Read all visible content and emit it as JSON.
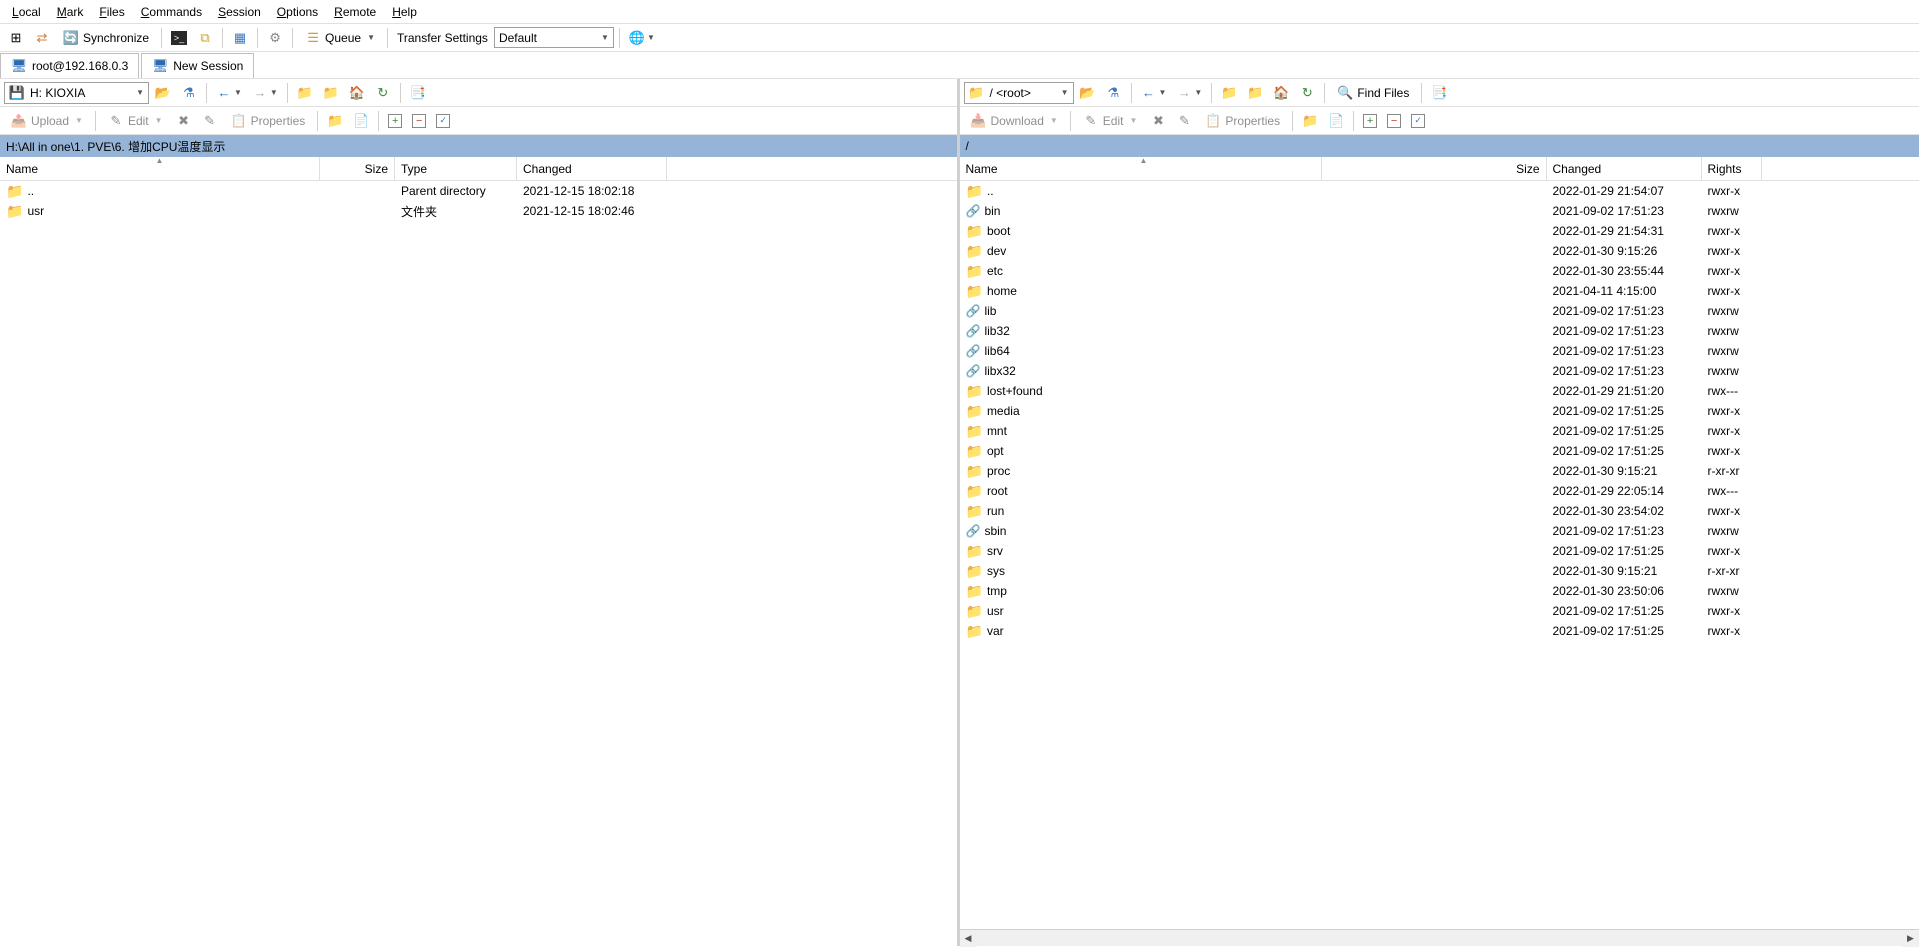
{
  "menu": [
    "Local",
    "Mark",
    "Files",
    "Commands",
    "Session",
    "Options",
    "Remote",
    "Help"
  ],
  "toolbar1": {
    "synchronize": "Synchronize",
    "queue": "Queue",
    "transfer_settings_label": "Transfer Settings",
    "transfer_settings_value": "Default"
  },
  "sessions": {
    "active": "root@192.168.0.3",
    "new": "New Session"
  },
  "local": {
    "drive": "H: KIOXIA",
    "path": "H:\\All in one\\1. PVE\\6. 增加CPU温度显示",
    "upload_label": "Upload",
    "edit_label": "Edit",
    "properties_label": "Properties",
    "headers": [
      "Name",
      "Size",
      "Type",
      "Changed"
    ],
    "rows": [
      {
        "name": "..",
        "icon": "parent",
        "size": "",
        "type": "Parent directory",
        "changed": "2021-12-15  18:02:18"
      },
      {
        "name": "usr",
        "icon": "folder",
        "size": "",
        "type": "文件夹",
        "changed": "2021-12-15  18:02:46"
      }
    ]
  },
  "remote": {
    "drive": "/ <root>",
    "path": "/",
    "download_label": "Download",
    "edit_label": "Edit",
    "properties_label": "Properties",
    "find_files": "Find Files",
    "headers": [
      "Name",
      "Size",
      "Changed",
      "Rights"
    ],
    "rows": [
      {
        "name": "..",
        "icon": "parent",
        "size": "",
        "changed": "2022-01-29 21:54:07",
        "rights": "rwxr-x"
      },
      {
        "name": "bin",
        "icon": "link",
        "size": "",
        "changed": "2021-09-02 17:51:23",
        "rights": "rwxrw"
      },
      {
        "name": "boot",
        "icon": "folder",
        "size": "",
        "changed": "2022-01-29 21:54:31",
        "rights": "rwxr-x"
      },
      {
        "name": "dev",
        "icon": "folder",
        "size": "",
        "changed": "2022-01-30 9:15:26",
        "rights": "rwxr-x"
      },
      {
        "name": "etc",
        "icon": "folder",
        "size": "",
        "changed": "2022-01-30 23:55:44",
        "rights": "rwxr-x"
      },
      {
        "name": "home",
        "icon": "folder",
        "size": "",
        "changed": "2021-04-11 4:15:00",
        "rights": "rwxr-x"
      },
      {
        "name": "lib",
        "icon": "link",
        "size": "",
        "changed": "2021-09-02 17:51:23",
        "rights": "rwxrw"
      },
      {
        "name": "lib32",
        "icon": "link",
        "size": "",
        "changed": "2021-09-02 17:51:23",
        "rights": "rwxrw"
      },
      {
        "name": "lib64",
        "icon": "link",
        "size": "",
        "changed": "2021-09-02 17:51:23",
        "rights": "rwxrw"
      },
      {
        "name": "libx32",
        "icon": "link",
        "size": "",
        "changed": "2021-09-02 17:51:23",
        "rights": "rwxrw"
      },
      {
        "name": "lost+found",
        "icon": "folder",
        "size": "",
        "changed": "2022-01-29 21:51:20",
        "rights": "rwx---"
      },
      {
        "name": "media",
        "icon": "folder",
        "size": "",
        "changed": "2021-09-02 17:51:25",
        "rights": "rwxr-x"
      },
      {
        "name": "mnt",
        "icon": "folder",
        "size": "",
        "changed": "2021-09-02 17:51:25",
        "rights": "rwxr-x"
      },
      {
        "name": "opt",
        "icon": "folder",
        "size": "",
        "changed": "2021-09-02 17:51:25",
        "rights": "rwxr-x"
      },
      {
        "name": "proc",
        "icon": "folder",
        "size": "",
        "changed": "2022-01-30 9:15:21",
        "rights": "r-xr-xr"
      },
      {
        "name": "root",
        "icon": "folder",
        "size": "",
        "changed": "2022-01-29 22:05:14",
        "rights": "rwx---"
      },
      {
        "name": "run",
        "icon": "folder",
        "size": "",
        "changed": "2022-01-30 23:54:02",
        "rights": "rwxr-x"
      },
      {
        "name": "sbin",
        "icon": "link",
        "size": "",
        "changed": "2021-09-02 17:51:23",
        "rights": "rwxrw"
      },
      {
        "name": "srv",
        "icon": "folder",
        "size": "",
        "changed": "2021-09-02 17:51:25",
        "rights": "rwxr-x"
      },
      {
        "name": "sys",
        "icon": "folder",
        "size": "",
        "changed": "2022-01-30 9:15:21",
        "rights": "r-xr-xr"
      },
      {
        "name": "tmp",
        "icon": "folder",
        "size": "",
        "changed": "2022-01-30 23:50:06",
        "rights": "rwxrw"
      },
      {
        "name": "usr",
        "icon": "folder",
        "size": "",
        "changed": "2021-09-02 17:51:25",
        "rights": "rwxr-x"
      },
      {
        "name": "var",
        "icon": "folder",
        "size": "",
        "changed": "2021-09-02 17:51:25",
        "rights": "rwxr-x"
      }
    ]
  }
}
